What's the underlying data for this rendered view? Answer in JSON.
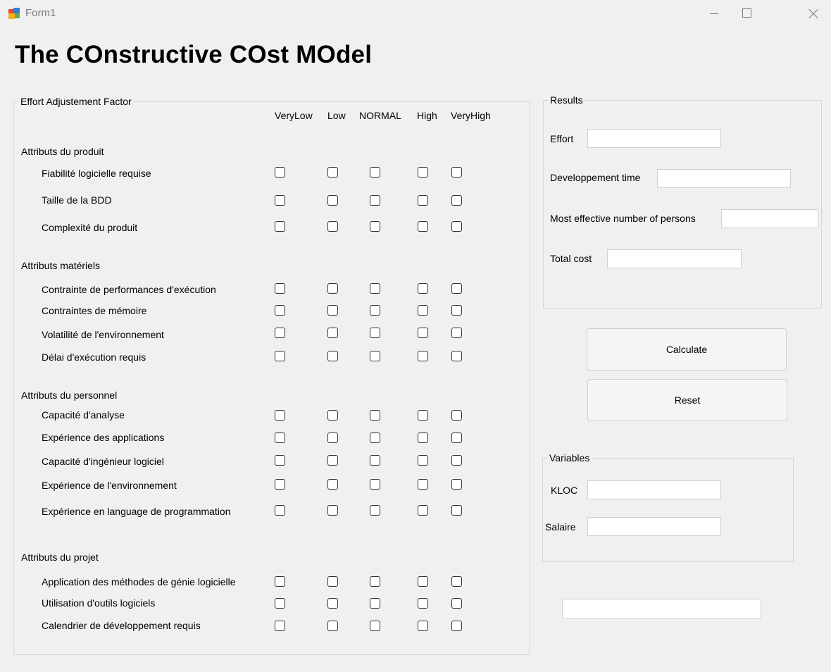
{
  "window": {
    "title": "Form1",
    "icon": "winforms-app-icon",
    "minimize_icon": "minimize-icon",
    "maximize_icon": "maximize-icon",
    "close_icon": "close-icon"
  },
  "heading": "The COnstructive COst MOdel",
  "effort_group": {
    "legend": "Effort Adjustement Factor",
    "columns": [
      "VeryLow",
      "Low",
      "NORMAL",
      "High",
      "VeryHigh"
    ],
    "sections": [
      {
        "title": "Attributs du produit",
        "attributes": [
          "Fiabilité logicielle requise",
          "Taille de la BDD",
          "Complexité du produit"
        ]
      },
      {
        "title": "Attributs matériels",
        "attributes": [
          "Contrainte de performances d'exécution",
          "Contraintes de mémoire",
          "Volatilité de l'environnement",
          "Délai d'exécution requis"
        ]
      },
      {
        "title": "Attributs du personnel",
        "attributes": [
          "Capacité d'analyse",
          "Expérience des applications",
          "Capacité d'ingénieur logiciel",
          "Expérience de l'environnement",
          "Expérience en language de programmation"
        ]
      },
      {
        "title": "Attributs du projet",
        "attributes": [
          "Application des méthodes de génie logicielle",
          "Utilisation d'outils logiciels",
          "Calendrier de développement requis"
        ]
      }
    ]
  },
  "results_group": {
    "legend": "Results",
    "effort_label": "Effort",
    "effort_value": "",
    "dev_time_label": "Developpement time",
    "dev_time_value": "",
    "persons_label": "Most effective number of persons",
    "persons_value": "",
    "total_cost_label": "Total cost",
    "total_cost_value": ""
  },
  "buttons": {
    "calculate": "Calculate",
    "reset": "Reset"
  },
  "variables_group": {
    "legend": "Variables",
    "kloc_label": "KLOC",
    "kloc_value": "",
    "salaire_label": "Salaire",
    "salaire_value": ""
  },
  "bottom_field_value": "",
  "checkbox_states": "all unchecked"
}
